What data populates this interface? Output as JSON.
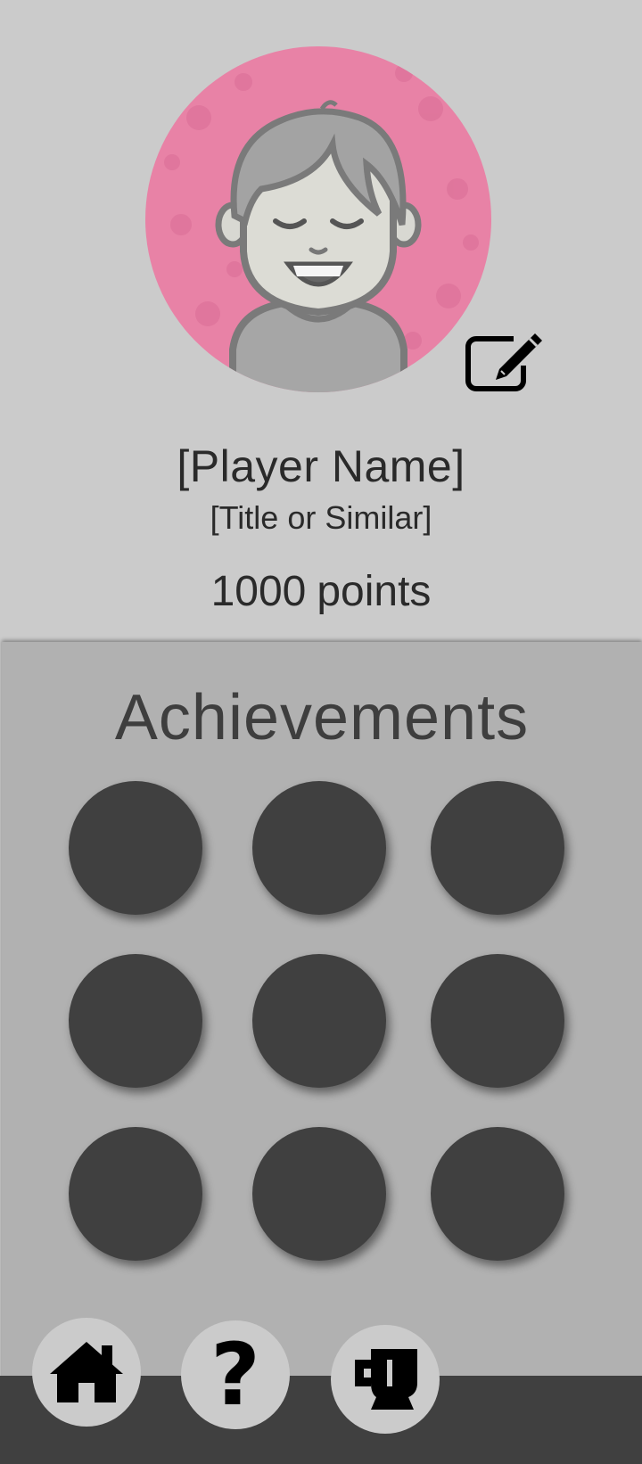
{
  "profile": {
    "name": "[Player Name]",
    "title": "[Title or Similar]",
    "points_value": "1000",
    "points_label": "points",
    "avatar_bg_color": "#e882a6",
    "edit_icon": "pencil-square-icon"
  },
  "achievements": {
    "heading": "Achievements",
    "badge_count": 9,
    "badge_color": "#404040"
  },
  "nav": {
    "items": [
      {
        "name": "home",
        "icon": "home-icon"
      },
      {
        "name": "help",
        "icon": "question-mark-icon",
        "glyph": "?"
      },
      {
        "name": "leaderboard",
        "icon": "trophy-icon"
      }
    ]
  }
}
